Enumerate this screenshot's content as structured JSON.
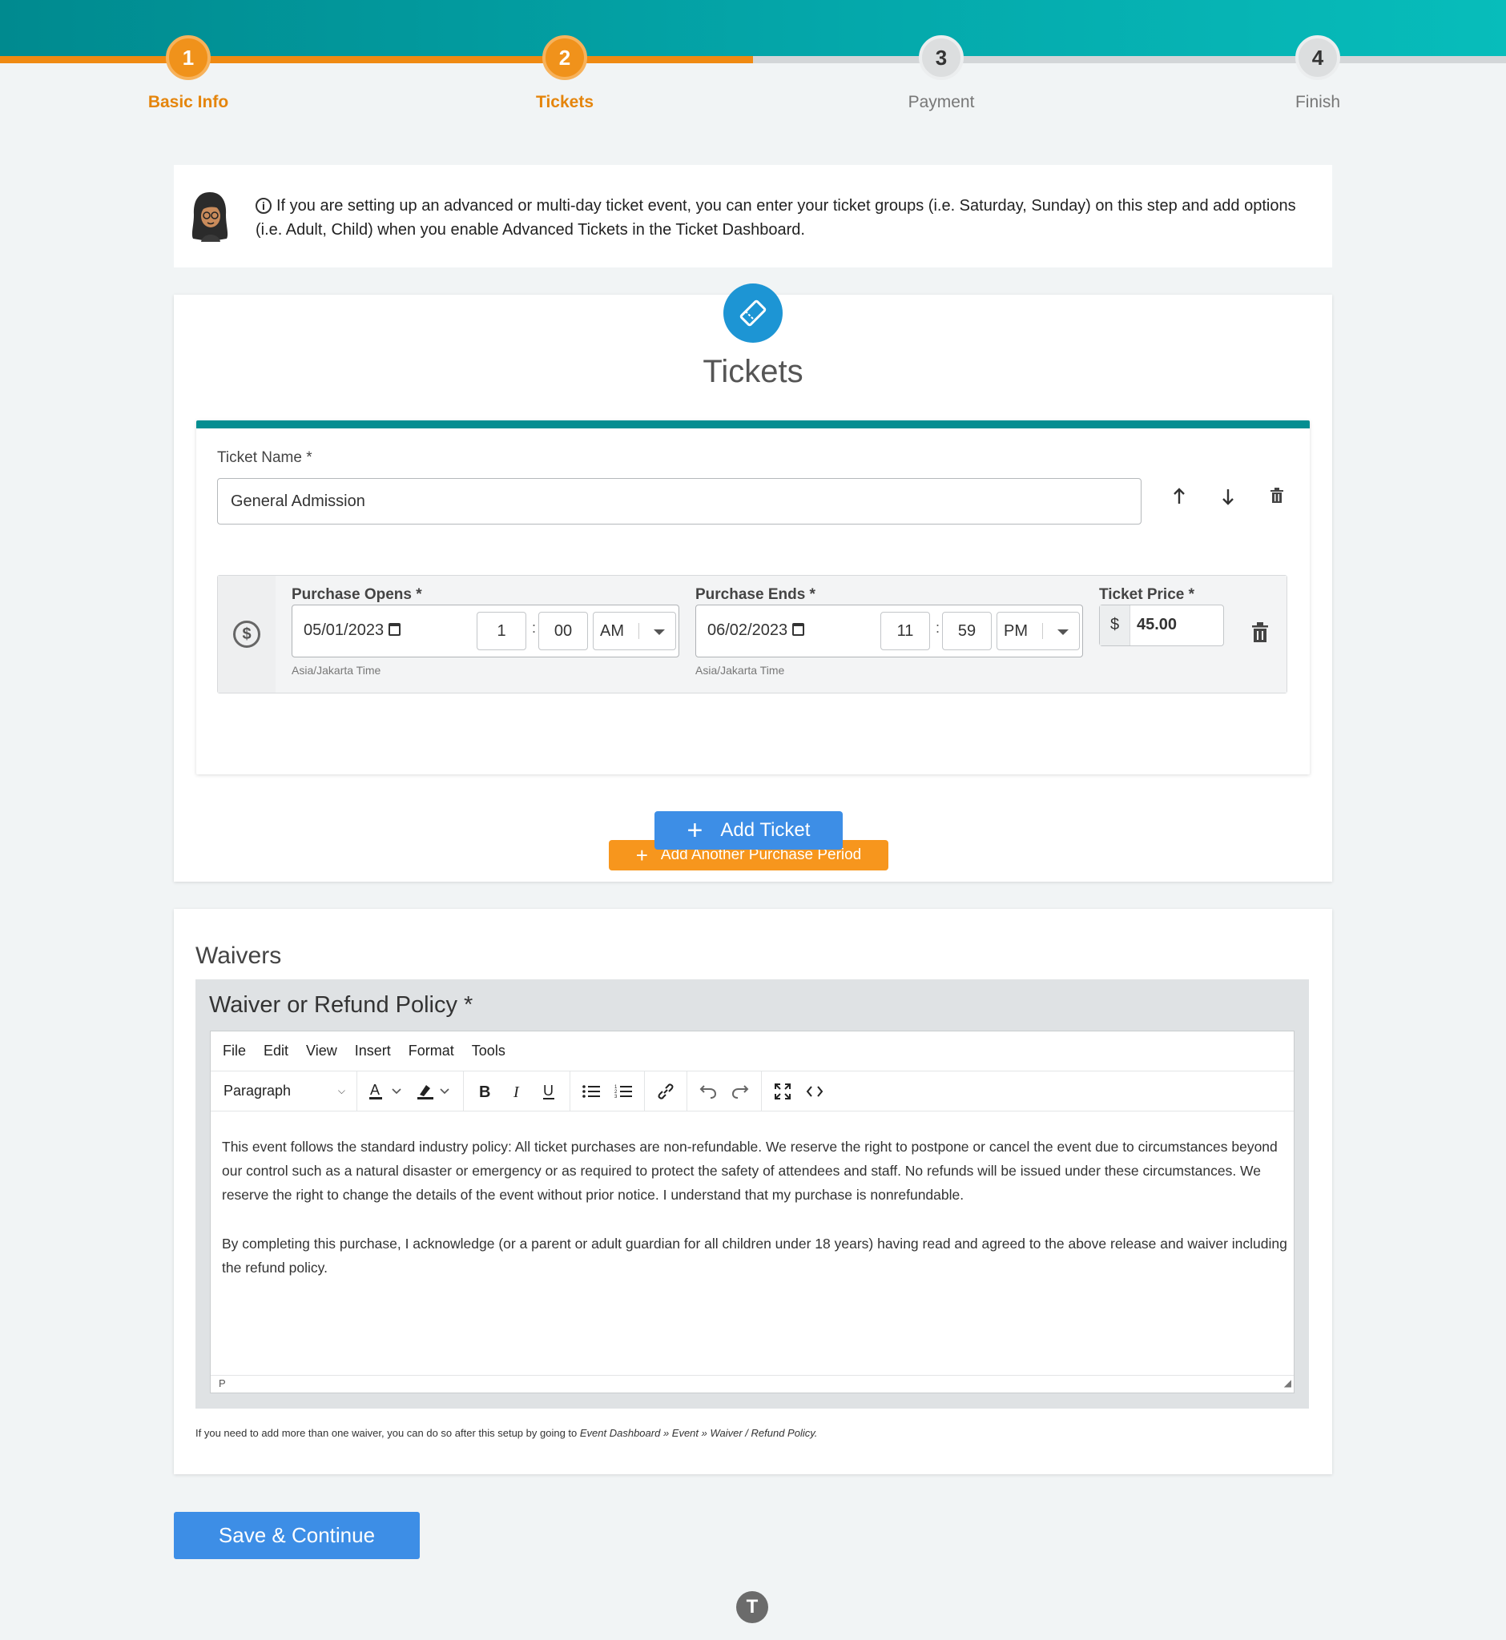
{
  "stepper": {
    "steps": [
      {
        "number": "1",
        "label": "Basic Info",
        "state": "complete"
      },
      {
        "number": "2",
        "label": "Tickets",
        "state": "current"
      },
      {
        "number": "3",
        "label": "Payment",
        "state": "upcoming"
      },
      {
        "number": "4",
        "label": "Finish",
        "state": "upcoming"
      }
    ],
    "progress": 0.5
  },
  "banner": {
    "text": "If you are setting up an advanced or multi-day ticket event, you can enter your ticket groups (i.e. Saturday, Sunday) on this step and add options (i.e. Adult, Child) when you enable Advanced Tickets in the Ticket Dashboard.",
    "icon": "info-icon"
  },
  "tickets": {
    "title": "Tickets",
    "badge_icon": "ticket-icon",
    "ticket_name_label": "Ticket Name *",
    "ticket_name_value": "General Admission",
    "purchase_opens_label": "Purchase Opens *",
    "purchase_ends_label": "Purchase Ends *",
    "ticket_price_label": "Ticket Price *",
    "opens": {
      "date": "05/01/2023",
      "hour": "1",
      "minute": "00",
      "ampm": "AM",
      "timezone": "Asia/Jakarta Time"
    },
    "ends": {
      "date": "06/02/2023",
      "hour": "11",
      "minute": "59",
      "ampm": "PM",
      "timezone": "Asia/Jakarta Time"
    },
    "colon": ":",
    "price_currency": "$",
    "price_value": "45.00",
    "add_period_label": "Add Another Purchase Period",
    "add_ticket_label": "Add Ticket"
  },
  "waivers": {
    "title": "Waivers",
    "editor_label": "Waiver or Refund Policy *",
    "menu": [
      "File",
      "Edit",
      "View",
      "Insert",
      "Format",
      "Tools"
    ],
    "block_format": "Paragraph",
    "paragraphs": [
      "This event follows the standard industry policy: All ticket purchases are non-refundable. We reserve the right to postpone or cancel the event due to circumstances beyond our control such as a natural disaster or emergency or as required to protect the safety of attendees and staff. No refunds will be issued under these circumstances. We reserve the right to change the details of the event without prior notice. I understand that my purchase is nonrefundable.",
      "By completing this purchase, I acknowledge (or a parent or adult guardian for all children under 18 years) having read and agreed to the above release and waiver including the refund policy."
    ],
    "status_path": "P",
    "note_prefix": "If you need to add more than one waiver, you can do so after this setup by going to ",
    "note_path": "Event Dashboard » Event » Waiver / Refund Policy."
  },
  "save_label": "Save & Continue",
  "footer_logo_letter": "T",
  "colors": {
    "teal": "#048e91",
    "orange": "#f0921b",
    "blue": "#3d8ee6",
    "ticket_badge": "#1d95d4"
  }
}
